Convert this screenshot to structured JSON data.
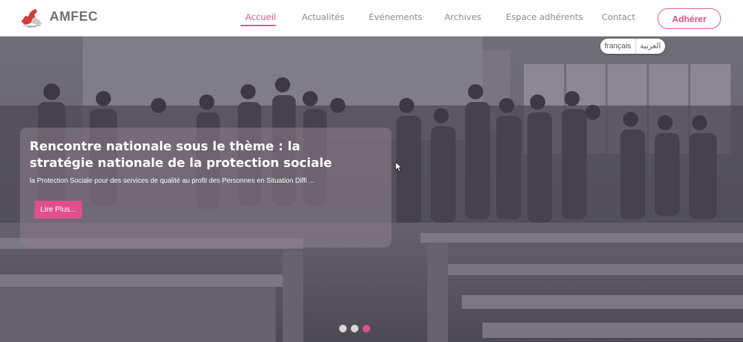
{
  "brand": {
    "name": "AMFEC",
    "logo_icon": "map-logo-icon"
  },
  "nav": {
    "items": [
      {
        "label": "Accueil",
        "active": true
      },
      {
        "label": "Actualités",
        "active": false
      },
      {
        "label": "Événements",
        "active": false
      },
      {
        "label": "Archives",
        "active": false
      },
      {
        "label": "Espace adhérents",
        "active": false
      },
      {
        "label": "Contact",
        "active": false
      }
    ],
    "cta_label": "Adhérer"
  },
  "language": {
    "options": [
      "français",
      "العربية"
    ],
    "selected": "français"
  },
  "hero": {
    "title": "Rencontre nationale sous le thème : la stratégie nationale de la protection sociale",
    "subtitle": "la Protection Sociale pour des services de qualité au profit des Personnes en Situation Diffi ...",
    "button_label": "Lire Plus...",
    "slides": 3,
    "active_slide": 3
  },
  "colors": {
    "accent": "#e0508a",
    "nav_text": "#8a8a90",
    "brand_text": "#6f6f74"
  }
}
